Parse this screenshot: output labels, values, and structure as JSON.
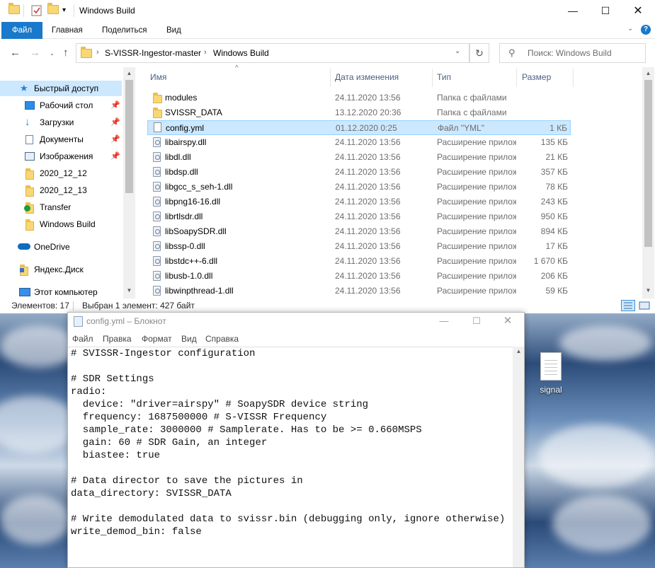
{
  "explorer": {
    "title": "Windows Build",
    "ribbon_tabs": [
      "Файл",
      "Главная",
      "Поделиться",
      "Вид"
    ],
    "breadcrumb": [
      "S-VISSR-Ingestor-master",
      "Windows Build"
    ],
    "search_placeholder": "Поиск: Windows Build",
    "nav_items": [
      {
        "label": "Быстрый доступ",
        "icon": "star-icon"
      },
      {
        "label": "Рабочий стол",
        "icon": "desktop-icon",
        "pinned": true
      },
      {
        "label": "Загрузки",
        "icon": "download-icon",
        "pinned": true
      },
      {
        "label": "Документы",
        "icon": "documents-icon",
        "pinned": true
      },
      {
        "label": "Изображения",
        "icon": "pictures-icon",
        "pinned": true
      },
      {
        "label": "2020_12_12",
        "icon": "folder-icon"
      },
      {
        "label": "2020_12_13",
        "icon": "folder-icon"
      },
      {
        "label": "Transfer",
        "icon": "folder-sync-icon"
      },
      {
        "label": "Windows Build",
        "icon": "folder-icon"
      },
      {
        "label": "OneDrive",
        "icon": "cloud-icon"
      },
      {
        "label": "Яндекс.Диск",
        "icon": "yandex-disk-icon"
      },
      {
        "label": "Этот компьютер",
        "icon": "computer-icon"
      }
    ],
    "columns": {
      "name": "Имя",
      "date": "Дата изменения",
      "type": "Тип",
      "size": "Размер"
    },
    "files": [
      {
        "name": "modules",
        "date": "24.11.2020 13:56",
        "type": "Папка с файлами",
        "size": "",
        "icon": "folder-icon"
      },
      {
        "name": "SVISSR_DATA",
        "date": "13.12.2020 20:36",
        "type": "Папка с файлами",
        "size": "",
        "icon": "folder-icon"
      },
      {
        "name": "config.yml",
        "date": "01.12.2020 0:25",
        "type": "Файл \"YML\"",
        "size": "1 КБ",
        "icon": "file-icon",
        "selected": true
      },
      {
        "name": "libairspy.dll",
        "date": "24.11.2020 13:56",
        "type": "Расширение приложения",
        "size": "135 КБ",
        "icon": "dll-icon"
      },
      {
        "name": "libdl.dll",
        "date": "24.11.2020 13:56",
        "type": "Расширение приложения",
        "size": "21 КБ",
        "icon": "dll-icon"
      },
      {
        "name": "libdsp.dll",
        "date": "24.11.2020 13:56",
        "type": "Расширение приложения",
        "size": "357 КБ",
        "icon": "dll-icon"
      },
      {
        "name": "libgcc_s_seh-1.dll",
        "date": "24.11.2020 13:56",
        "type": "Расширение приложения",
        "size": "78 КБ",
        "icon": "dll-icon"
      },
      {
        "name": "libpng16-16.dll",
        "date": "24.11.2020 13:56",
        "type": "Расширение приложения",
        "size": "243 КБ",
        "icon": "dll-icon"
      },
      {
        "name": "librtlsdr.dll",
        "date": "24.11.2020 13:56",
        "type": "Расширение приложения",
        "size": "950 КБ",
        "icon": "dll-icon"
      },
      {
        "name": "libSoapySDR.dll",
        "date": "24.11.2020 13:56",
        "type": "Расширение приложения",
        "size": "894 КБ",
        "icon": "dll-icon"
      },
      {
        "name": "libssp-0.dll",
        "date": "24.11.2020 13:56",
        "type": "Расширение приложения",
        "size": "17 КБ",
        "icon": "dll-icon"
      },
      {
        "name": "libstdc++-6.dll",
        "date": "24.11.2020 13:56",
        "type": "Расширение приложения",
        "size": "1 670 КБ",
        "icon": "dll-icon"
      },
      {
        "name": "libusb-1.0.dll",
        "date": "24.11.2020 13:56",
        "type": "Расширение приложения",
        "size": "206 КБ",
        "icon": "dll-icon"
      },
      {
        "name": "libwinpthread-1.dll",
        "date": "24.11.2020 13:56",
        "type": "Расширение приложения",
        "size": "59 КБ",
        "icon": "dll-icon"
      }
    ],
    "status_items": "Элементов: 17",
    "status_selected": "Выбран 1 элемент: 427 байт"
  },
  "notepad": {
    "title": "config.yml – Блокнот",
    "menu": [
      "Файл",
      "Правка",
      "Формат",
      "Вид",
      "Справка"
    ],
    "content": "# SVISSR-Ingestor configuration\n\n# SDR Settings\nradio:\n  device: \"driver=airspy\" # SoapySDR device string\n  frequency: 1687500000 # S-VISSR Frequency\n  sample_rate: 3000000 # Samplerate. Has to be >= 0.660MSPS\n  gain: 60 # SDR Gain, an integer\n  biastee: true\n\n# Data director to save the pictures in\ndata_directory: SVISSR_DATA\n\n# Write demodulated data to svissr.bin (debugging only, ignore otherwise)\nwrite_demod_bin: false"
  },
  "desktop": {
    "icon_label": "signal"
  }
}
